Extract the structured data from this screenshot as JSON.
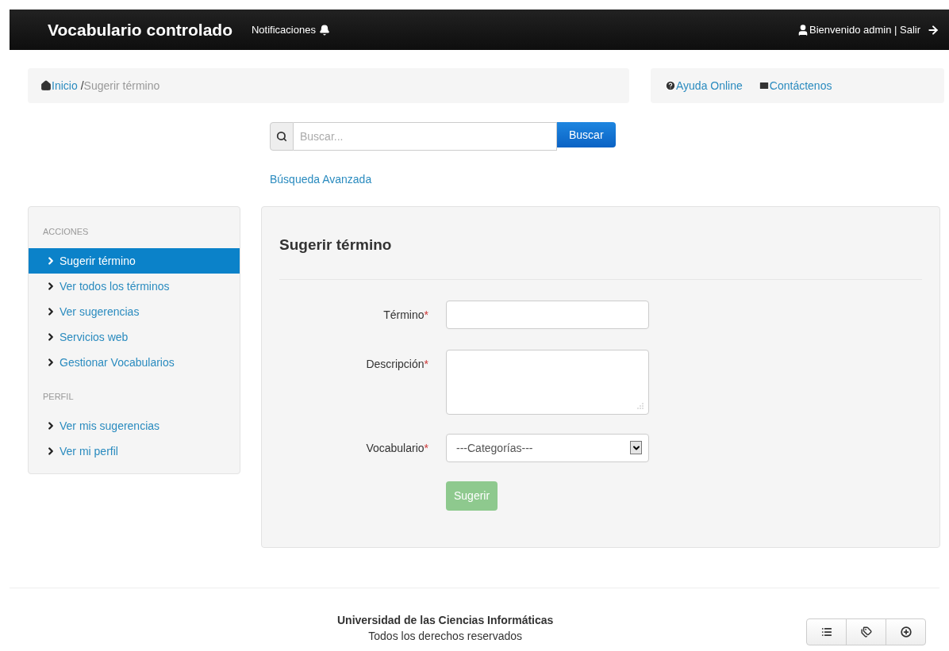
{
  "navbar": {
    "brand": "Vocabulario controlado",
    "notifications": "Notificaciones",
    "user": "Bienvenido admin | Salir"
  },
  "breadcrumb": [
    {
      "label": "Inicio",
      "kind": "link"
    },
    {
      "label": "/",
      "kind": "separator"
    },
    {
      "label": "Sugerir término",
      "kind": "current"
    }
  ],
  "help_links": [
    {
      "label": "Ayuda Online",
      "kind": "help"
    },
    {
      "label": "Contáctenos",
      "kind": "mail"
    }
  ],
  "search": {
    "placeholder": "Buscar...",
    "button": "Buscar",
    "advanced": "Búsqueda Avanzada"
  },
  "sidebar": {
    "sections": [
      {
        "title": "ACCIONES",
        "items": [
          {
            "label": "Sugerir término",
            "selected": true
          },
          {
            "label": "Ver todos los términos",
            "selected": false
          },
          {
            "label": "Ver sugerencias",
            "selected": false
          },
          {
            "label": "Servicios web",
            "selected": false
          },
          {
            "label": "Gestionar Vocabularios",
            "selected": false
          }
        ]
      },
      {
        "title": "PERFIL",
        "items": [
          {
            "label": "Ver mis sugerencias",
            "selected": false
          },
          {
            "label": "Ver mi perfil",
            "selected": false
          }
        ]
      }
    ]
  },
  "form": {
    "title": "Sugerir término",
    "fields": [
      {
        "label": "Término",
        "required_mark": "*",
        "kind": "text"
      },
      {
        "label": "Descripción",
        "required_mark": "*",
        "kind": "textarea"
      },
      {
        "label": "Vocabulario",
        "required_mark": "*",
        "kind": "select",
        "value": "---Categorías---"
      }
    ],
    "submit": {
      "label": "Sugerir",
      "disabled": true
    }
  },
  "footer": {
    "title": "Universidad de las Ciencias Informáticas",
    "subtitle": "Todos los derechos reservados",
    "buttons": [
      {
        "kind": "list"
      },
      {
        "kind": "tags"
      },
      {
        "kind": "plus"
      }
    ]
  }
}
